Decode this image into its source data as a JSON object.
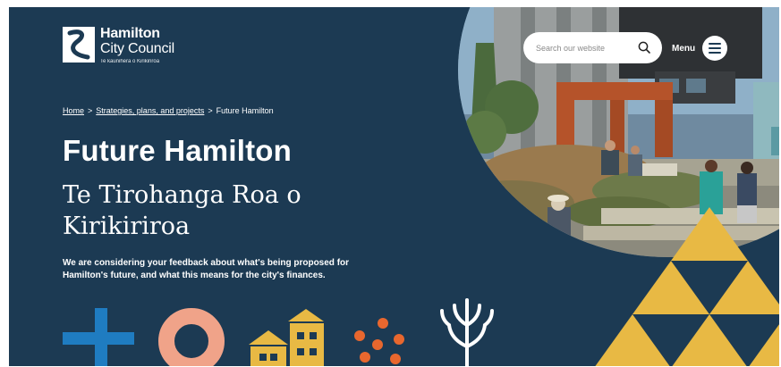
{
  "header": {
    "logo": {
      "line1": "Hamilton",
      "line2": "City Council",
      "sub": "Te kaunihera o Kirikiriroa"
    },
    "search": {
      "placeholder": "Search our website",
      "icon": "magnifier"
    },
    "menu": {
      "label": "Menu",
      "icon": "hamburger"
    }
  },
  "breadcrumb": {
    "items": [
      "Home",
      "Strategies, plans, and projects",
      "Future Hamilton"
    ],
    "separator": ">"
  },
  "hero": {
    "title": "Future Hamilton",
    "subtitle_line1": "Te Tirohanga Roa o",
    "subtitle_line2": "Kirikiriroa",
    "description": "We are considering your feedback about what's being proposed for Hamilton's future, and what this means for the city's finances."
  },
  "colors": {
    "background": "#1c3a53",
    "accent_yellow": "#e8b944",
    "accent_blue": "#1f7cc1",
    "accent_peach": "#f0a389",
    "accent_orange": "#e8672e",
    "text": "#ffffff"
  }
}
